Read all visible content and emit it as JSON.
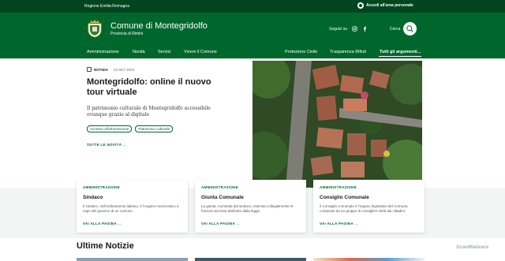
{
  "topbar": {
    "region": "Regione Emilia-Romagna",
    "login": "Accedi all'area personale"
  },
  "header": {
    "title": "Comune di Montegridolfo",
    "subtitle": "Provincia di Rimini",
    "follow_label": "Seguici su",
    "search_label": "Cerca",
    "social_icons": [
      "instagram-icon",
      "facebook-icon"
    ]
  },
  "nav": {
    "items": [
      "Amministrazione",
      "Novità",
      "Servizi",
      "Vivere il Comune"
    ],
    "right_items": [
      "Protezione Civile",
      "Trasparenza Rifiuti",
      "Tutti gli argomenti..."
    ]
  },
  "hero": {
    "tag": "NOTIZIA",
    "date": "23 SET 2023",
    "title": "Montegridolfo: online il nuovo tour virtuale",
    "description": "Il patrimonio culturale di Montegridolfo accessibile ovunque grazie al digitale",
    "chips": [
      "Accesso all'informazione",
      "Patrimonio culturale"
    ],
    "all_news": "TUTTE LE NOVITÀ"
  },
  "cards": [
    {
      "category": "AMMINISTRAZIONE",
      "title": "Sindaco",
      "description": "Il sindaco, nell'ordinamento italiano, è l'organo monocratico a capo del governo di un comune.",
      "link": "VAI ALLA PAGINA"
    },
    {
      "category": "AMMINISTRAZIONE",
      "title": "Giunta Comunale",
      "description": "La giunta, nominata dal sindaco, esercita collegialmente le funzioni ad essa attribuite dalla legge.",
      "link": "VAI ALLA PAGINA"
    },
    {
      "category": "AMMINISTRAZIONE",
      "title": "Consiglio Comunale",
      "description": "Il Consiglio Comunale è l'organo legislativo del Comune, composto da un gruppo di consiglieri eletti dai cittadini.",
      "link": "VAI ALLA PAGINA"
    }
  ],
  "news_section": {
    "title": "Ultime Notizie"
  },
  "watermark": "ScanMalware",
  "colors": {
    "brand_dark": "#00451f",
    "brand": "#00672c"
  }
}
